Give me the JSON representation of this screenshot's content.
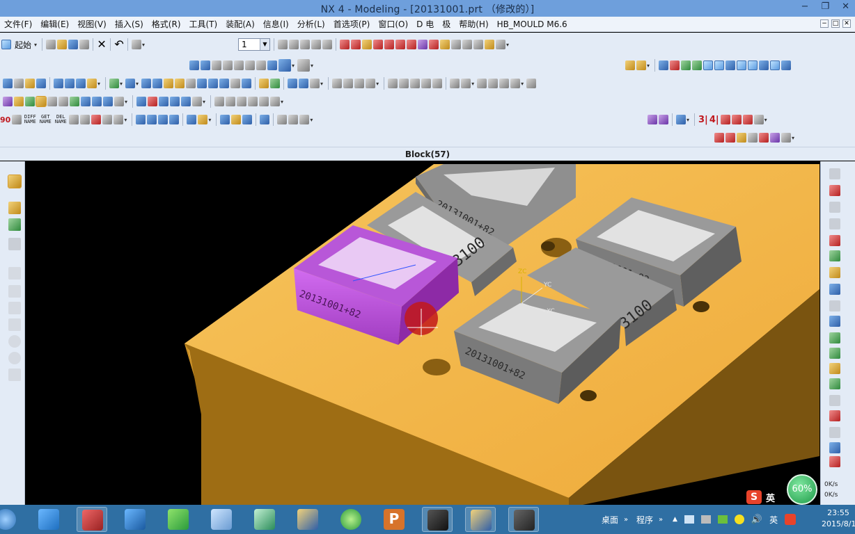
{
  "window": {
    "title": "NX 4 - Modeling - [20131001.prt （修改的）]",
    "min": "−",
    "restore": "❐",
    "close": "✕"
  },
  "menu": {
    "items": [
      "文件(F)",
      "编辑(E)",
      "视图(V)",
      "插入(S)",
      "格式(R)",
      "工具(T)",
      "装配(A)",
      "信息(I)",
      "分析(L)",
      "首选项(P)",
      "窗口(O)",
      "D 电",
      "极",
      "帮助(H)",
      "HB_MOULD M6.6"
    ],
    "mdi": [
      "−",
      "□",
      "✕"
    ]
  },
  "toolbar": {
    "start_label": "起始",
    "layer_value": "1",
    "diff_names": [
      "DIFF NAME",
      "GET NAME",
      "DEL NAME"
    ],
    "red_text_1": "3|",
    "red_text_2": "4|"
  },
  "cue": {
    "selection": "Block(57)"
  },
  "model": {
    "engraving_main": "20131001+82",
    "engraving_side": "3100",
    "triad_z": "ZC",
    "triad_y": "YC",
    "triad_x": "XC",
    "colors": {
      "plate_top": "#f4b548",
      "plate_side": "#b8801e",
      "plate_front": "#8d6212",
      "insert": "#8a8a8a",
      "insert_dark": "#5e5e5e",
      "selected": "#c34ee0",
      "selected_dark": "#8d2aa6"
    }
  },
  "tray": {
    "net_percent": "60%",
    "up_rate": "0K/s",
    "down_rate": "0K/s",
    "ime_label": "英",
    "desktop": "桌面",
    "programs": "程序",
    "lang": "英",
    "time": "23:55",
    "date": "2015/8/1"
  }
}
